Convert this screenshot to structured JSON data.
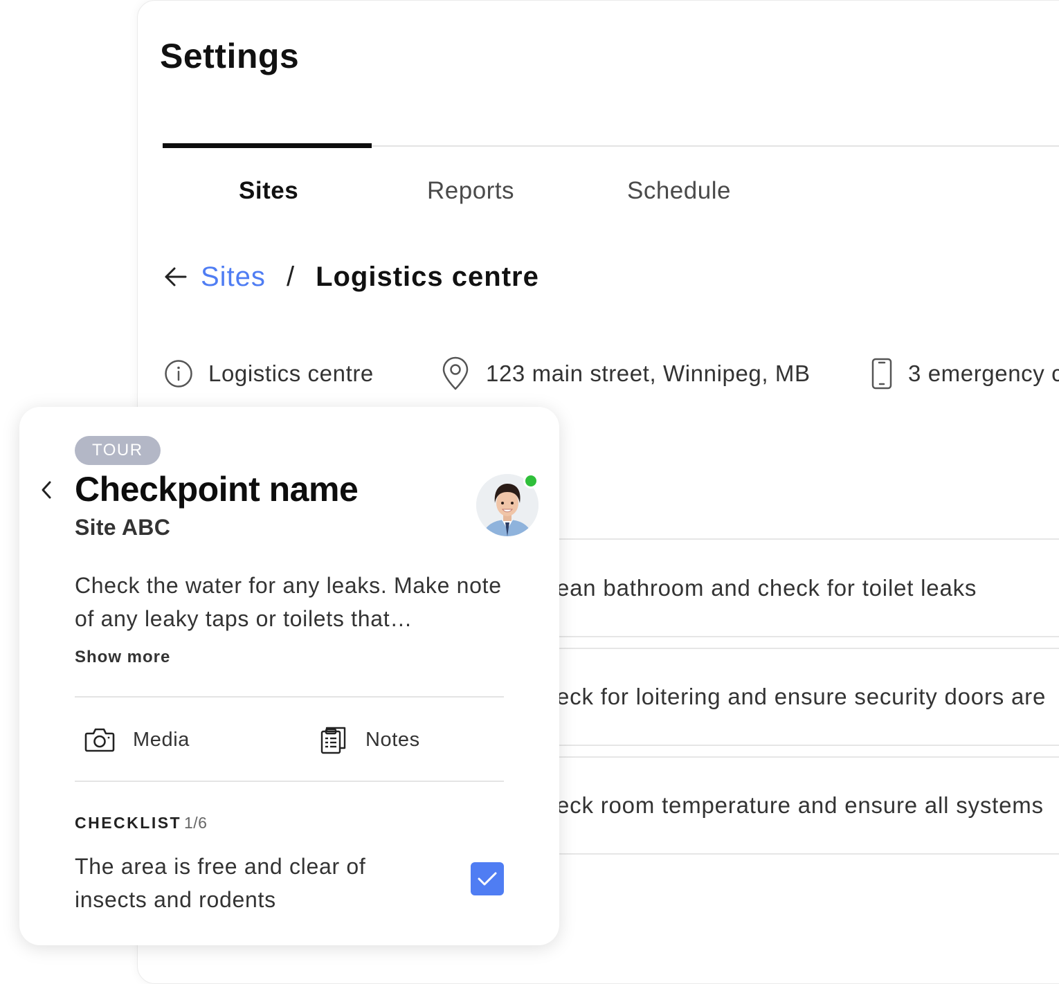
{
  "page": {
    "title": "Settings"
  },
  "tabs": [
    {
      "label": "Sites",
      "active": true
    },
    {
      "label": "Reports",
      "active": false
    },
    {
      "label": "Schedule",
      "active": false
    }
  ],
  "breadcrumb": {
    "parent": "Sites",
    "separator": "/",
    "current": "Logistics centre"
  },
  "site_info": {
    "name": "Logistics centre",
    "address": "123 main street, Winnipeg, MB",
    "contacts": "3 emergency c"
  },
  "tasks": [
    "ean bathroom and check for toilet leaks",
    "eck for loitering and ensure security doors are",
    "eck room temperature and ensure all systems"
  ],
  "checkpoint_card": {
    "badge": "TOUR",
    "title": "Checkpoint name",
    "subtitle": "Site ABC",
    "description": "Check the water for any leaks. Make note of any leaky taps or toilets that…",
    "show_more": "Show more",
    "actions": {
      "media": "Media",
      "notes": "Notes"
    },
    "checklist": {
      "heading": "CHECKLIST",
      "count": "1/6",
      "item_text": "The area is free and clear of insects and rodents",
      "item_checked": true
    },
    "user_online": true
  },
  "colors": {
    "accent": "#4f7df3",
    "online": "#2fbf3a",
    "badge": "#b3b7c6",
    "text": "#333333"
  },
  "icons": {
    "back": "arrow-left-icon",
    "info": "info-circle-icon",
    "location": "map-pin-icon",
    "phone": "mobile-phone-icon",
    "card_back": "chevron-left-icon",
    "media": "camera-icon",
    "notes": "clipboard-icon",
    "check": "checkmark-icon"
  }
}
